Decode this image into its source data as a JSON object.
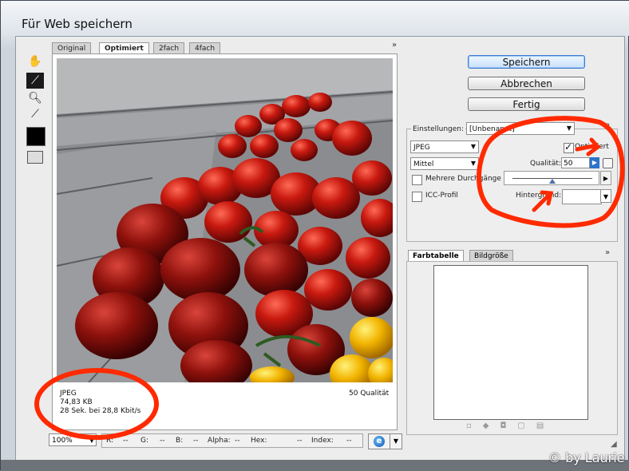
{
  "window": {
    "title": "Für Web speichern"
  },
  "tabs": [
    {
      "label": "Original"
    },
    {
      "label": "Optimiert"
    },
    {
      "label": "2fach"
    },
    {
      "label": "4fach"
    }
  ],
  "tools": [
    "hand-tool-icon",
    "slice-select-tool-icon",
    "zoom-tool-icon",
    "eyedropper-tool-icon",
    "eyedropper-color-icon",
    "toggle-slices-icon"
  ],
  "preview_info": {
    "format": "JPEG",
    "size": "74,83 KB",
    "download_time": "28 Sek. bei 28,8 Kbit/s",
    "quality_label": "50 Qualität"
  },
  "status": {
    "zoom": "100%",
    "r_label": "R:",
    "r_val": "--",
    "g_label": "G:",
    "g_val": "--",
    "b_label": "B:",
    "b_val": "--",
    "alpha_label": "Alpha:",
    "alpha_val": "--",
    "hex_label": "Hex:",
    "hex_val": "--",
    "index_label": "Index:",
    "index_val": "--"
  },
  "buttons": {
    "save": "Speichern",
    "cancel": "Abbrechen",
    "done": "Fertig"
  },
  "settings": {
    "label": "Einstellungen:",
    "preset": "[Unbenannt]",
    "format": "JPEG",
    "quality_preset": "Mittel",
    "optimized_label": "Optimiert",
    "optimized_checked": true,
    "quality_label": "Qualität:",
    "quality_value": "50",
    "progressive_label": "Mehrere Durchgänge",
    "progressive_checked": false,
    "icc_label": "ICC-Profil",
    "icc_checked": false,
    "matte_label": "Hintergrund:",
    "quality_slider_fraction": 0.5
  },
  "color_panel": {
    "tab_colortable": "Farbtabelle",
    "tab_imagesize": "Bildgröße"
  },
  "watermark": "© by Laurie",
  "colors": {
    "accent": "#2e73c9",
    "annotation": "#ff2a00"
  }
}
